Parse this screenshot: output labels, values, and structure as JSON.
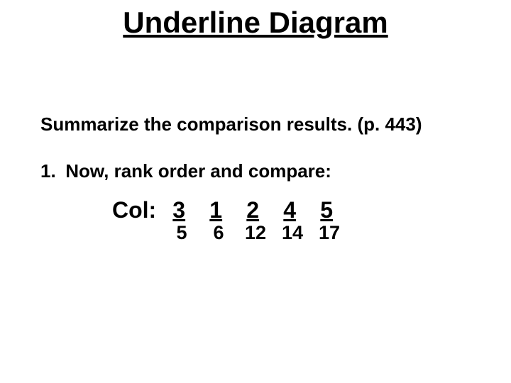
{
  "title": "Underline Diagram",
  "summarize": "Summarize the comparison results. (p. 443)",
  "rank_num": "1.",
  "rank_text": "Now, rank order and compare:",
  "col_label": "Col:",
  "top": {
    "c0": "3",
    "c1": "1",
    "c2": "2",
    "c3": "4",
    "c4": "5"
  },
  "bot": {
    "c0": "5",
    "c1": "6",
    "c2": "12",
    "c3": "14",
    "c4": "17"
  }
}
